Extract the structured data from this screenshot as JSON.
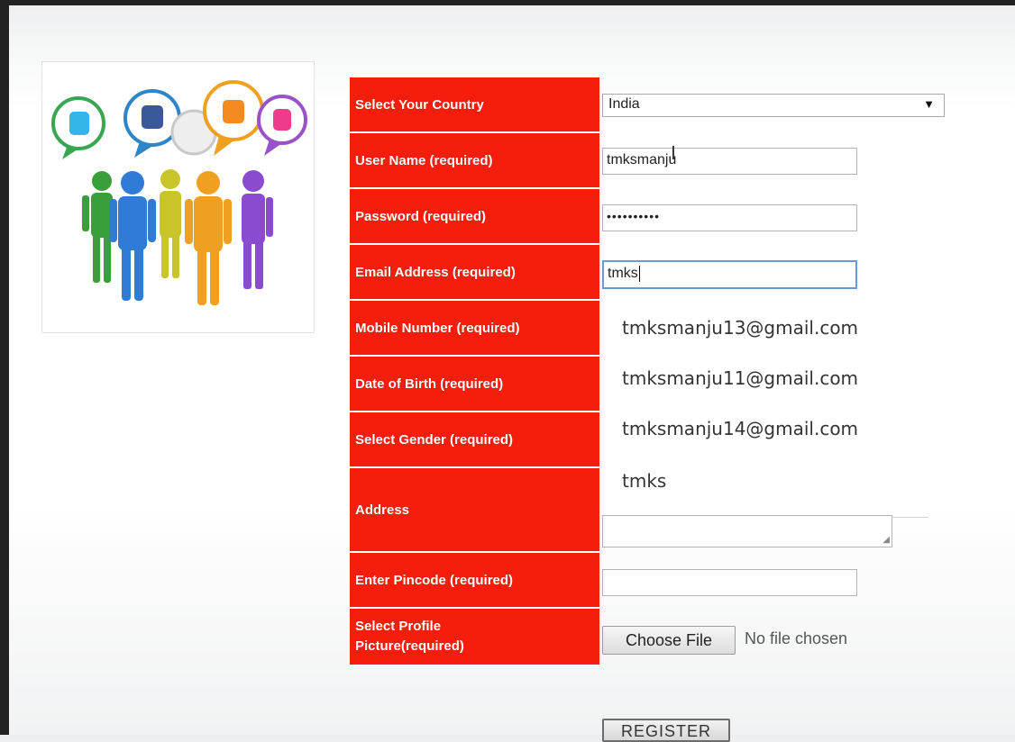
{
  "form": {
    "country_label": "Select Your Country",
    "username_label": "User Name (required)",
    "password_label": "Password (required)",
    "email_label": "Email Address (required)",
    "mobile_label": "Mobile Number (required)",
    "dob_label": "Date of Birth (required)",
    "gender_label": "Select Gender (required)",
    "address_label": "Address",
    "pincode_label": "Enter Pincode (required)",
    "profile_label_line1": "Select Profile",
    "profile_label_line2": "Picture(required)",
    "country_value": "India",
    "username_value": "tmksmanju",
    "password_value": "••••••••••",
    "email_value": "tmks",
    "pincode_value": "",
    "choose_file_label": "Choose File",
    "no_file_text": "No file chosen",
    "register_label": "REGISTER"
  },
  "autocomplete": {
    "suggestions": [
      "tmksmanju13@gmail.com",
      "tmksmanju11@gmail.com",
      "tmksmanju14@gmail.com",
      "tmks"
    ]
  },
  "logo": {
    "icons": [
      "twitter-icon",
      "facebook-icon",
      "blogger-icon",
      "flickr-icon"
    ],
    "colors": {
      "label_bg": "#f51e0c",
      "people": [
        "#3a9e3a",
        "#2f7bd6",
        "#c9c42a",
        "#f0a020",
        "#8a4bd0"
      ]
    }
  }
}
